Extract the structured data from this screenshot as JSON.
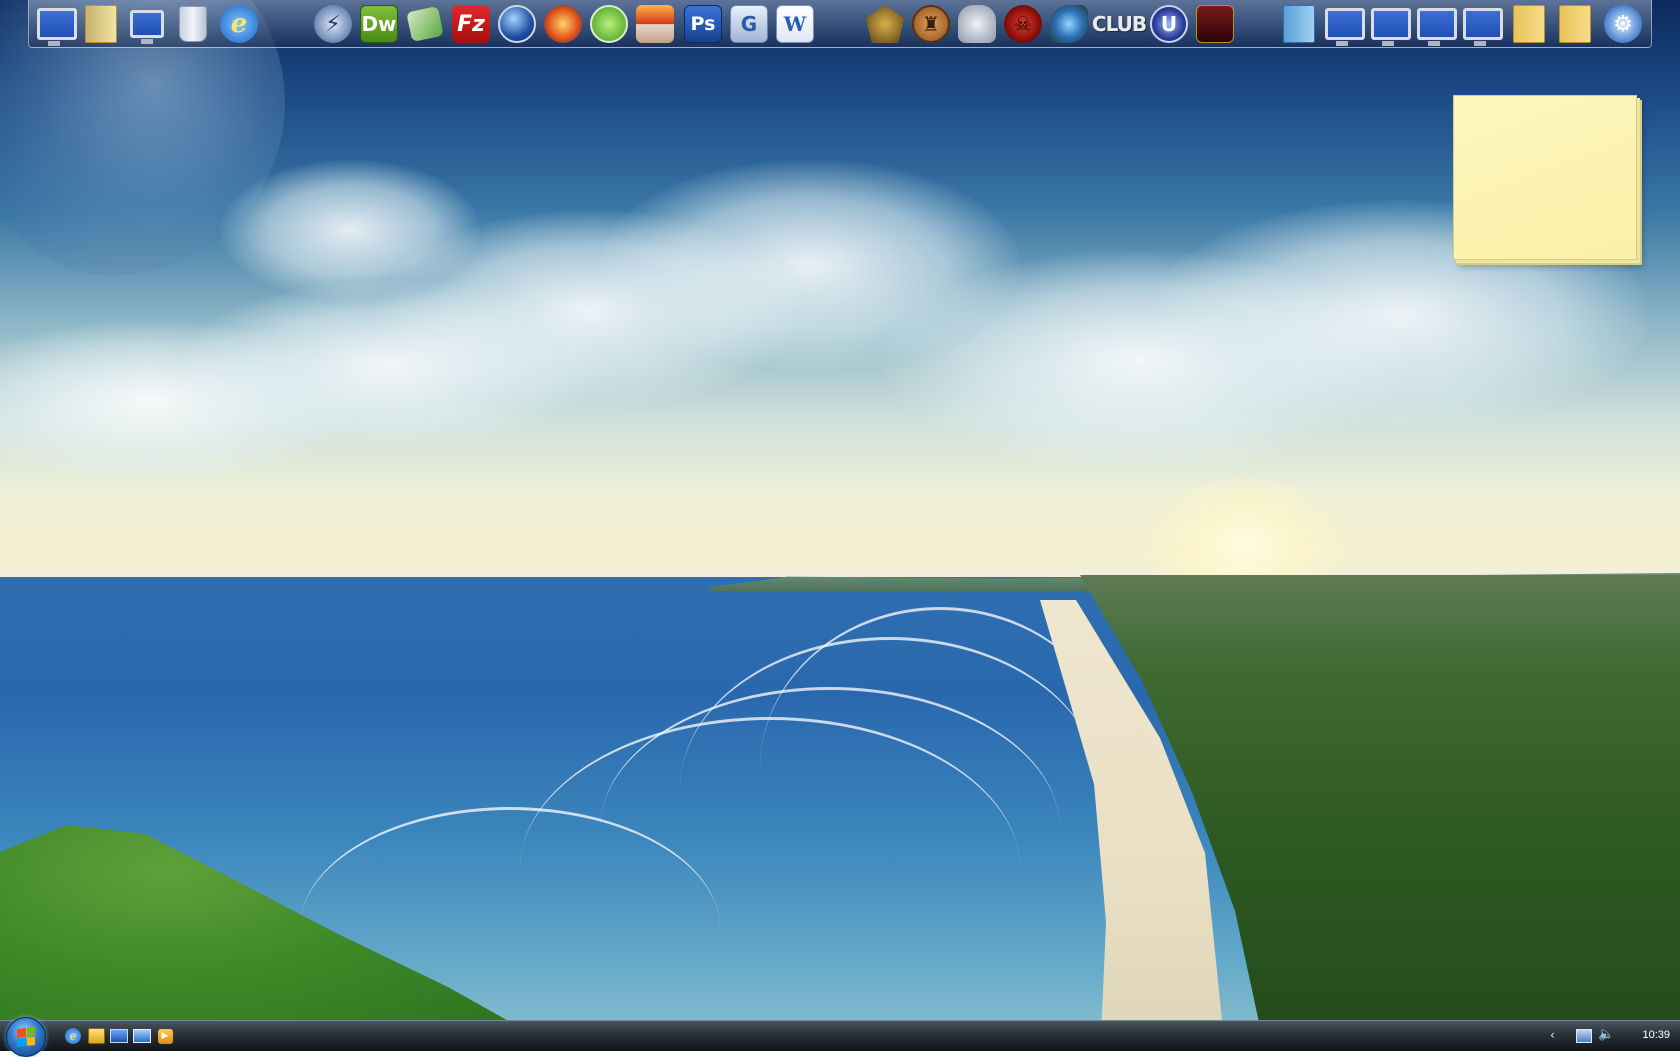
{
  "desktop": {
    "wallpaper": "beach-coastline-wallpaper"
  },
  "dock": {
    "icons": [
      {
        "name": "computer-icon"
      },
      {
        "name": "documents-icon"
      },
      {
        "name": "network-icon"
      },
      {
        "name": "recycle-bin-icon"
      },
      {
        "name": "internet-explorer-icon"
      },
      {
        "name": "download-accelerator-icon"
      },
      {
        "name": "dreamweaver-icon",
        "label": "Dw"
      },
      {
        "name": "image-viewer-icon"
      },
      {
        "name": "filezilla-icon",
        "label": "Fz"
      },
      {
        "name": "google-earth-icon"
      },
      {
        "name": "nero-burning-icon"
      },
      {
        "name": "windows-live-icon"
      },
      {
        "name": "nero-startsmart-icon"
      },
      {
        "name": "photoshop-icon",
        "label": "Ps"
      },
      {
        "name": "media-center-icon"
      },
      {
        "name": "word-icon",
        "label": "W"
      },
      {
        "name": "samurai-game-icon"
      },
      {
        "name": "bronze-medal-game-icon"
      },
      {
        "name": "robot-game-icon"
      },
      {
        "name": "gears-of-war-icon"
      },
      {
        "name": "spore-game-icon"
      },
      {
        "name": "club-game-icon",
        "label": "CLUB"
      },
      {
        "name": "unreal-tournament-icon",
        "label": "U"
      },
      {
        "name": "heroes-game-icon"
      },
      {
        "name": "downloads-icon"
      },
      {
        "name": "network-drive-1-icon"
      },
      {
        "name": "network-drive-2-icon"
      },
      {
        "name": "network-drive-3-icon"
      },
      {
        "name": "network-drive-4-icon"
      },
      {
        "name": "folder-1-icon"
      },
      {
        "name": "folder-2-icon"
      },
      {
        "name": "control-panel-icon"
      }
    ]
  },
  "sticky_note": {
    "text": ""
  },
  "taskbar": {
    "quick_launch": [
      {
        "name": "ie-quicklaunch-icon"
      },
      {
        "name": "outlook-quicklaunch-icon"
      },
      {
        "name": "show-desktop-icon"
      },
      {
        "name": "switch-windows-icon"
      },
      {
        "name": "media-player-quicklaunch-icon"
      }
    ],
    "clock": "10:39"
  }
}
